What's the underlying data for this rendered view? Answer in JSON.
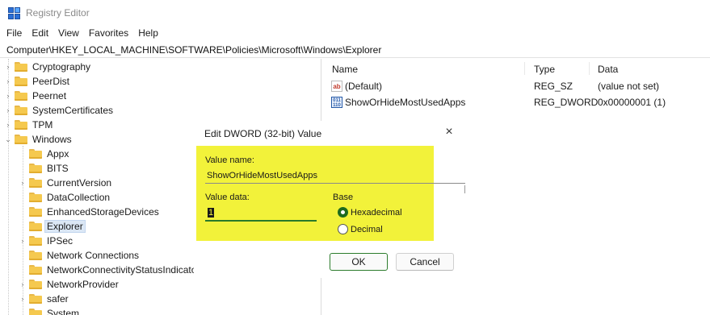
{
  "window": {
    "title": "Registry Editor"
  },
  "menu": [
    "File",
    "Edit",
    "View",
    "Favorites",
    "Help"
  ],
  "address": "Computer\\HKEY_LOCAL_MACHINE\\SOFTWARE\\Policies\\Microsoft\\Windows\\Explorer",
  "tree": {
    "items": [
      {
        "label": "Cryptography",
        "expander": "›",
        "selected": false
      },
      {
        "label": "PeerDist",
        "expander": "›",
        "selected": false
      },
      {
        "label": "Peernet",
        "expander": "›",
        "selected": false
      },
      {
        "label": "SystemCertificates",
        "expander": "›",
        "selected": false
      },
      {
        "label": "TPM",
        "expander": "›",
        "selected": false
      },
      {
        "label": "Windows",
        "expander": "⌄",
        "selected": false
      },
      {
        "label": "Appx",
        "expander": "",
        "selected": false
      },
      {
        "label": "BITS",
        "expander": "",
        "selected": false
      },
      {
        "label": "CurrentVersion",
        "expander": "›",
        "selected": false
      },
      {
        "label": "DataCollection",
        "expander": "",
        "selected": false
      },
      {
        "label": "EnhancedStorageDevices",
        "expander": "",
        "selected": false
      },
      {
        "label": "Explorer",
        "expander": "",
        "selected": true
      },
      {
        "label": "IPSec",
        "expander": "›",
        "selected": false
      },
      {
        "label": "Network Connections",
        "expander": "",
        "selected": false
      },
      {
        "label": "NetworkConnectivityStatusIndicator",
        "expander": "",
        "selected": false
      },
      {
        "label": "NetworkProvider",
        "expander": "›",
        "selected": false
      },
      {
        "label": "safer",
        "expander": "›",
        "selected": false
      },
      {
        "label": "System",
        "expander": "",
        "selected": false
      }
    ]
  },
  "list": {
    "columns": {
      "name": "Name",
      "type": "Type",
      "data": "Data"
    },
    "rows": [
      {
        "icon": "ab",
        "name": "(Default)",
        "type": "REG_SZ",
        "data": "(value not set)"
      },
      {
        "icon": "binary",
        "name": "ShowOrHideMostUsedApps",
        "type": "REG_DWORD",
        "data": "0x00000001 (1)"
      }
    ]
  },
  "dialog": {
    "title": "Edit DWORD (32-bit) Value",
    "close_icon": "×",
    "value_name_label": "Value name:",
    "value_name": "ShowOrHideMostUsedApps",
    "value_data_label": "Value data:",
    "value_data": "1",
    "base_label": "Base",
    "base_options": [
      {
        "label": "Hexadecimal",
        "checked": true
      },
      {
        "label": "Decimal",
        "checked": false
      }
    ],
    "ok_label": "OK",
    "cancel_label": "Cancel",
    "highlight_color": "#f2f23a"
  },
  "colors": {
    "folder": "#f5c94f",
    "selection": "#dbe7f5",
    "focus": "#2a7a2a"
  }
}
